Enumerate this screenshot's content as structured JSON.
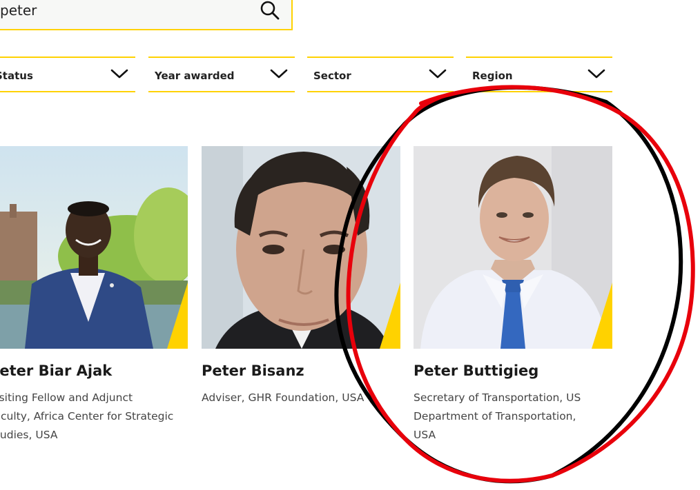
{
  "search": {
    "value": "peter",
    "icon": "search-icon"
  },
  "filters": [
    {
      "label": "Status",
      "icon": "chevron-down-icon"
    },
    {
      "label": "Year awarded",
      "icon": "chevron-down-icon"
    },
    {
      "label": "Sector",
      "icon": "chevron-down-icon"
    },
    {
      "label": "Region",
      "icon": "chevron-down-icon"
    }
  ],
  "results": [
    {
      "name": "Peter Biar Ajak",
      "role": [
        "Visiting Fellow and Adjunct",
        "Faculty, Africa Center for Strategic",
        "Studies, USA"
      ]
    },
    {
      "name": "Peter Bisanz",
      "role": [
        "Adviser, GHR Foundation, USA"
      ]
    },
    {
      "name": "Peter Buttigieg",
      "role": [
        "Secretary of Transportation, US",
        "Department of Transportation,",
        "USA"
      ]
    }
  ],
  "colors": {
    "accent": "#ffd200",
    "annotation_red": "#e8000b",
    "annotation_black": "#000000"
  }
}
